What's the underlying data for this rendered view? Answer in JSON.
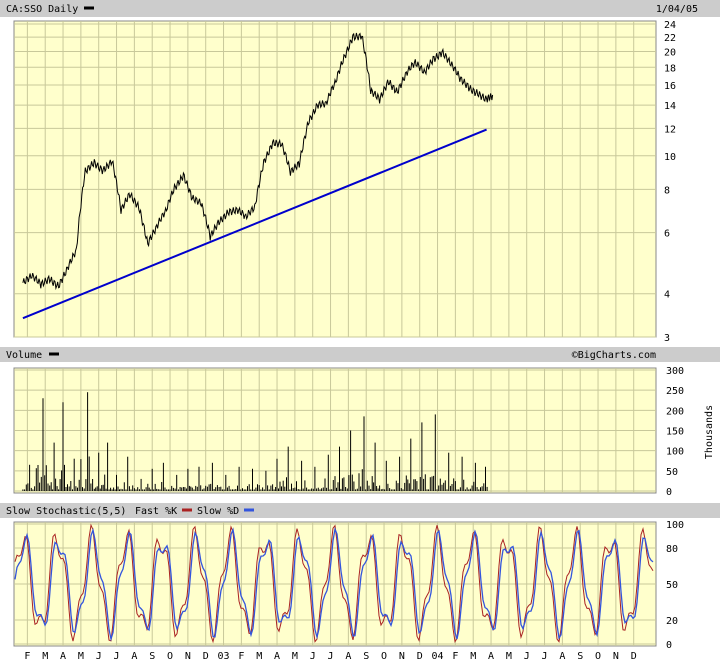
{
  "chart_data": [
    {
      "type": "line",
      "title": "CA:SSO Daily",
      "date": "1/04/05",
      "y_scale": "log",
      "ylim": [
        3,
        24
      ],
      "yticks": [
        3,
        4,
        6,
        8,
        10,
        12,
        14,
        16,
        18,
        20,
        22,
        24
      ],
      "grid": true,
      "series": [
        {
          "name": "CA:SSO Daily",
          "color": "#000000",
          "x": [
            0,
            2,
            4,
            6,
            8,
            10,
            12,
            14,
            16,
            18,
            20,
            22,
            24,
            26,
            28,
            30,
            32,
            34,
            36,
            38,
            40,
            42,
            44,
            46,
            48,
            50,
            52,
            54,
            56,
            58,
            60,
            62,
            64,
            66,
            68,
            70,
            72,
            74,
            76,
            78,
            80,
            82,
            84,
            86,
            88,
            90,
            92,
            94,
            96,
            98,
            100,
            102,
            104
          ],
          "values": [
            4.3,
            4.4,
            4.2,
            4.5,
            4.3,
            4.7,
            5.2,
            9.0,
            9.8,
            9.2,
            9.5,
            6.8,
            7.8,
            7.3,
            5.6,
            6.1,
            6.8,
            8.2,
            9.0,
            7.5,
            7.1,
            5.8,
            6.6,
            7.0,
            6.9,
            6.5,
            7.1,
            9.8,
            11.0,
            10.6,
            8.8,
            9.6,
            12.8,
            14.0,
            13.8,
            16.0,
            19.5,
            22.5,
            22.0,
            15.0,
            14.5,
            16.8,
            15.5,
            17.0,
            18.2,
            17.5,
            19.5,
            20.0,
            18.0,
            16.5,
            16.0,
            15.5,
            14.5
          ]
        },
        {
          "name": "Trendline",
          "color": "#0000cc",
          "x": [
            0,
            104
          ],
          "values": [
            3.4,
            11.9
          ]
        }
      ]
    },
    {
      "type": "bar",
      "title": "Volume",
      "credit": "©BigCharts.com",
      "ylabel": "Thousands",
      "ylim": [
        0,
        300
      ],
      "yticks": [
        0,
        50,
        100,
        150,
        200,
        250,
        300
      ],
      "x": [
        0,
        3,
        6,
        8,
        10,
        13,
        16,
        18,
        20,
        22,
        25,
        28,
        30,
        33,
        36,
        38,
        41,
        44,
        47,
        50,
        53,
        56,
        58,
        61,
        64,
        67,
        70,
        72,
        75,
        78,
        80,
        83,
        86,
        88,
        91,
        94,
        97,
        100,
        103
      ],
      "values": [
        65,
        230,
        120,
        220,
        80,
        245,
        95,
        120,
        40,
        85,
        30,
        55,
        70,
        40,
        55,
        60,
        70,
        40,
        60,
        55,
        50,
        80,
        110,
        75,
        60,
        90,
        110,
        150,
        185,
        120,
        75,
        85,
        130,
        170,
        190,
        95,
        85,
        70,
        60
      ]
    },
    {
      "type": "line",
      "title": "Slow Stochastic(5,5)",
      "legend": [
        "Fast %K",
        "Slow %D"
      ],
      "ylim": [
        0,
        100
      ],
      "yticks": [
        0,
        20,
        50,
        80,
        100
      ],
      "series": [
        {
          "name": "Fast %K",
          "color": "#aa2222"
        },
        {
          "name": "Slow %D",
          "color": "#3355dd"
        }
      ]
    }
  ],
  "x_axis": {
    "ticks": [
      {
        "label": "F",
        "x": 1
      },
      {
        "label": "M",
        "x": 5
      },
      {
        "label": "A",
        "x": 9
      },
      {
        "label": "M",
        "x": 13
      },
      {
        "label": "J",
        "x": 17
      },
      {
        "label": "J",
        "x": 21
      },
      {
        "label": "A",
        "x": 25
      },
      {
        "label": "S",
        "x": 29
      },
      {
        "label": "O",
        "x": 33
      },
      {
        "label": "N",
        "x": 37
      },
      {
        "label": "D",
        "x": 41
      },
      {
        "label": "03",
        "x": 45
      },
      {
        "label": "F",
        "x": 49
      },
      {
        "label": "M",
        "x": 53
      },
      {
        "label": "A",
        "x": 57
      },
      {
        "label": "M",
        "x": 61
      },
      {
        "label": "J",
        "x": 65
      },
      {
        "label": "J",
        "x": 69
      },
      {
        "label": "A",
        "x": 73
      },
      {
        "label": "S",
        "x": 77
      },
      {
        "label": "O",
        "x": 81
      },
      {
        "label": "N",
        "x": 85
      },
      {
        "label": "D",
        "x": 89
      },
      {
        "label": "04",
        "x": 93
      },
      {
        "label": "F",
        "x": 97
      },
      {
        "label": "M",
        "x": 101
      },
      {
        "label": "A",
        "x": 105
      },
      {
        "label": "M",
        "x": 109
      },
      {
        "label": "J",
        "x": 113
      },
      {
        "label": "J",
        "x": 117
      },
      {
        "label": "A",
        "x": 121
      },
      {
        "label": "S",
        "x": 125
      },
      {
        "label": "O",
        "x": 129
      },
      {
        "label": "N",
        "x": 133
      },
      {
        "label": "D",
        "x": 137
      }
    ],
    "range": [
      -2,
      142
    ]
  },
  "colors": {
    "plot_bg": "#ffffcc",
    "header_bg": "#cccccc",
    "grid": "#c8c89a"
  }
}
